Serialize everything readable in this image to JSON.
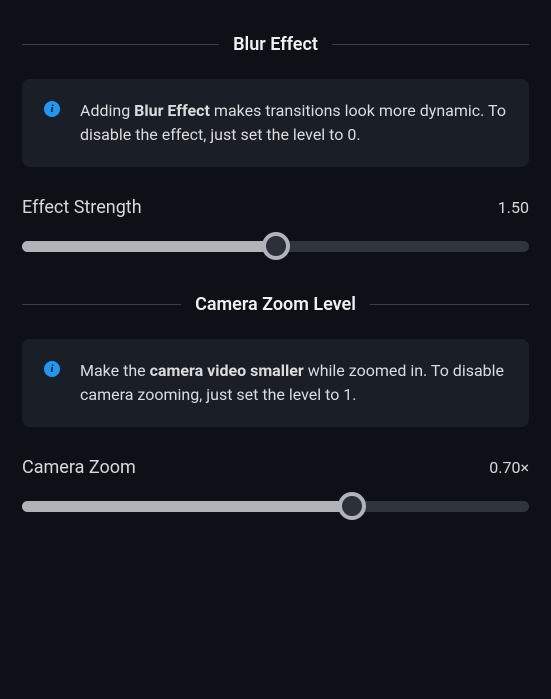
{
  "sections": [
    {
      "title": "Blur Effect",
      "info_prefix": "Adding ",
      "info_bold": "Blur Effect",
      "info_suffix": " makes transitions look more dynamic. To disable the effect, just set the level to 0.",
      "slider_label": "Effect Strength",
      "slider_value": "1.50",
      "slider_fill_pct": 50
    },
    {
      "title": "Camera Zoom Level",
      "info_prefix": "Make the ",
      "info_bold": "camera video smaller",
      "info_suffix": " while zoomed in. To disable camera zooming, just set the level to 1.",
      "slider_label": "Camera Zoom",
      "slider_value": "0.70×",
      "slider_fill_pct": 65
    }
  ]
}
